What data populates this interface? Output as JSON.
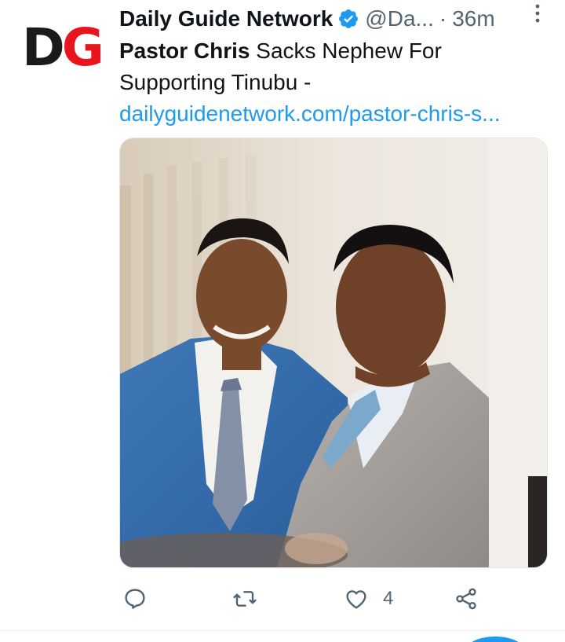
{
  "tweet": {
    "author_name": "Daily Guide Network",
    "handle": "@Da...",
    "separator": "·",
    "time": "36m",
    "avatar_letters": {
      "first": "D",
      "second": "G"
    },
    "text_bold": "Pastor Chris",
    "text_rest": " Sacks Nephew For Supporting Tinubu -",
    "link": "dailyguidenetwork.com/pastor-chris-s...",
    "media_icon": "photo-two-men-in-suits",
    "actions": {
      "reply_icon": "reply-icon",
      "retweet_icon": "retweet-icon",
      "like_icon": "like-icon",
      "like_count": "4",
      "share_icon": "share-icon"
    }
  },
  "colors": {
    "link": "#1d9bf0",
    "verified": "#1d9bf0",
    "muted": "#536471",
    "logo_red": "#e8141e",
    "logo_dark": "#1b1b1b"
  }
}
